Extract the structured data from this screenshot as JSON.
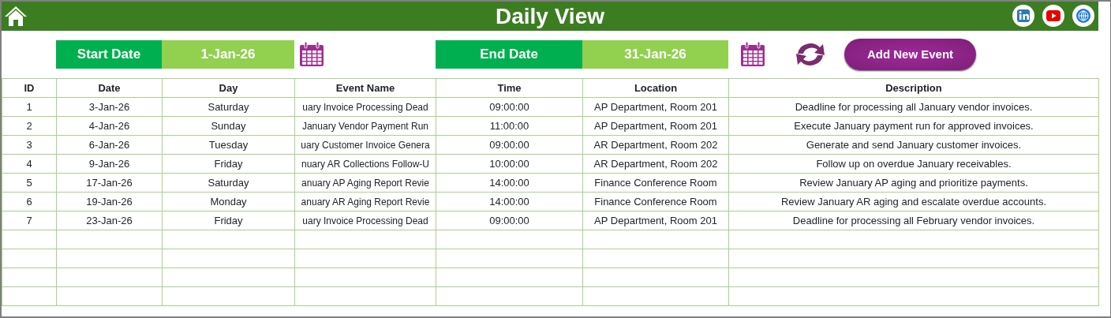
{
  "header": {
    "title": "Daily View"
  },
  "filters": [
    {
      "label": "Start Date",
      "value": "1-Jan-26"
    },
    {
      "label": "End Date",
      "value": "31-Jan-26"
    }
  ],
  "add_button": {
    "label": "Add New Event"
  },
  "table": {
    "columns": [
      "ID",
      "Date",
      "Day",
      "Event Name",
      "Time",
      "Location",
      "Description"
    ],
    "rows": [
      [
        "1",
        "3-Jan-26",
        "Saturday",
        "uary Invoice Processing Dead",
        "09:00:00",
        "AP Department, Room 201",
        "Deadline for processing all January vendor invoices."
      ],
      [
        "2",
        "4-Jan-26",
        "Sunday",
        "January Vendor Payment Run",
        "11:00:00",
        "AP Department, Room 201",
        "Execute January payment run for approved invoices."
      ],
      [
        "3",
        "6-Jan-26",
        "Tuesday",
        "uary Customer Invoice Genera",
        "09:00:00",
        "AR Department, Room 202",
        "Generate and send January customer invoices."
      ],
      [
        "4",
        "9-Jan-26",
        "Friday",
        "nuary AR Collections Follow-U",
        "10:00:00",
        "AR Department, Room 202",
        "Follow up on overdue January receivables."
      ],
      [
        "5",
        "17-Jan-26",
        "Saturday",
        "anuary AP Aging Report Revie",
        "14:00:00",
        "Finance Conference Room",
        "Review January AP aging and prioritize payments."
      ],
      [
        "6",
        "19-Jan-26",
        "Monday",
        "anuary AR Aging Report Revie",
        "14:00:00",
        "Finance Conference Room",
        "Review January AR aging and escalate overdue accounts."
      ],
      [
        "7",
        "23-Jan-26",
        "Friday",
        "uary Invoice Processing Dead",
        "09:00:00",
        "AP Department, Room 201",
        "Deadline for processing all February vendor invoices."
      ]
    ]
  }
}
